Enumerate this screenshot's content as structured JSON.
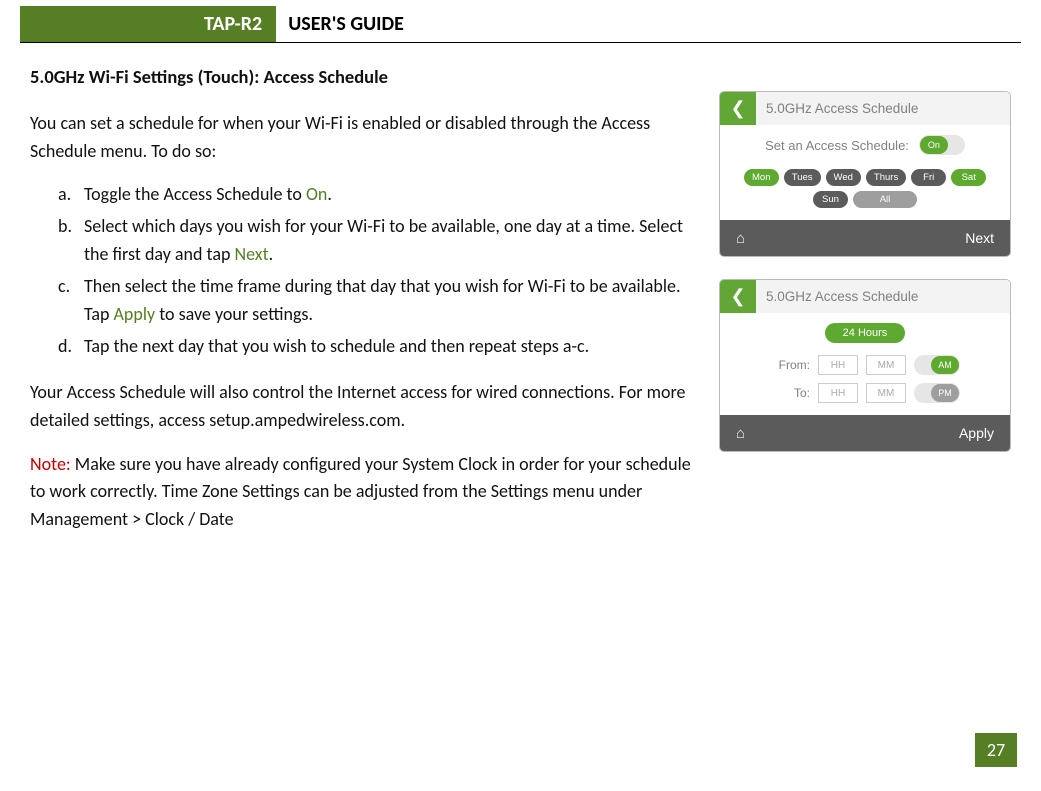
{
  "header": {
    "badge": "TAP-R2",
    "title": "USER'S GUIDE"
  },
  "section_title": "5.0GHz Wi-Fi Settings (Touch): Access Schedule",
  "intro": "You can set a schedule for when your Wi-Fi is enabled or disabled through the Access Schedule menu. To do so:",
  "steps": {
    "a": {
      "letter": "a.",
      "pre": "Toggle the Access Schedule to ",
      "hl": "On",
      "post": "."
    },
    "b": {
      "letter": "b.",
      "pre": "Select which days you wish for your Wi-Fi to be available, one day at a time. Select the first day and tap ",
      "hl": "Next",
      "post": "."
    },
    "c": {
      "letter": "c.",
      "pre": "Then select the time frame during that day that you wish for Wi-Fi to be available. Tap ",
      "hl": "Apply",
      "post": " to save your settings."
    },
    "d": {
      "letter": "d.",
      "text": "Tap the next day that you wish to schedule and then repeat steps a-c."
    }
  },
  "after": "Your Access Schedule will also control the Internet access for wired connections. For more detailed settings, access setup.ampedwireless.com.",
  "note": {
    "label": "Note:",
    "text": "  Make sure you have already configured your System Clock in order for your schedule to work correctly.  Time Zone Settings can be adjusted from the Settings menu under Management > Clock / Date"
  },
  "screen1": {
    "title": "5.0GHz Access Schedule",
    "set_label": "Set an Access Schedule:",
    "toggle_text": "On",
    "days": [
      "Mon",
      "Tues",
      "Wed",
      "Thurs",
      "Fri",
      "Sat",
      "Sun",
      "All"
    ],
    "footer_btn": "Next"
  },
  "screen2": {
    "title": "5.0GHz Access Schedule",
    "chip": "24 Hours",
    "from": "From:",
    "to": "To:",
    "hh": "HH",
    "mm": "MM",
    "am": "AM",
    "pm": "PM",
    "footer_btn": "Apply"
  },
  "page_number": "27"
}
